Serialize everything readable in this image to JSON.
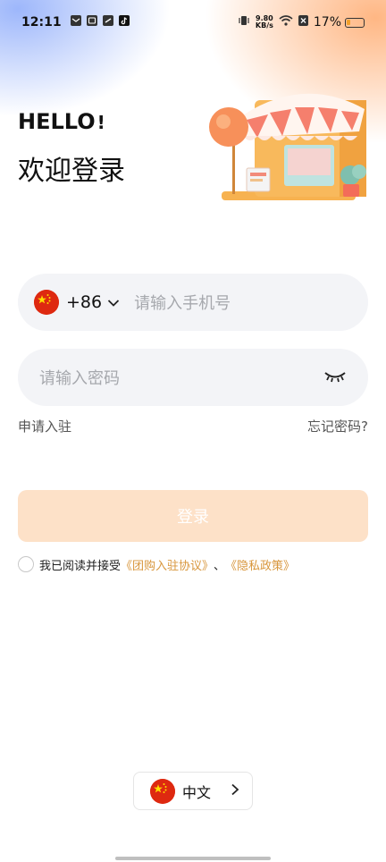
{
  "status_bar": {
    "time": "12:11",
    "net_speed_value": "9.80",
    "net_speed_unit": "KB/s",
    "battery": "17%"
  },
  "hero": {
    "hello": "HELLO",
    "exclaim": "!",
    "welcome": "欢迎登录"
  },
  "phone": {
    "country_code": "+86",
    "placeholder": "请输入手机号"
  },
  "password": {
    "placeholder": "请输入密码"
  },
  "links": {
    "apply": "申请入驻",
    "forgot": "忘记密码?"
  },
  "login_button": "登录",
  "agreement": {
    "prefix": "我已阅读并接受",
    "agreement_link": "《团购入驻协议》",
    "separator": "、",
    "privacy_link": "《隐私政策》"
  },
  "language": {
    "label": "中文"
  },
  "colors": {
    "accent": "#d8963c",
    "button_disabled": "#fde1c8",
    "field_bg": "#f3f4f7"
  }
}
